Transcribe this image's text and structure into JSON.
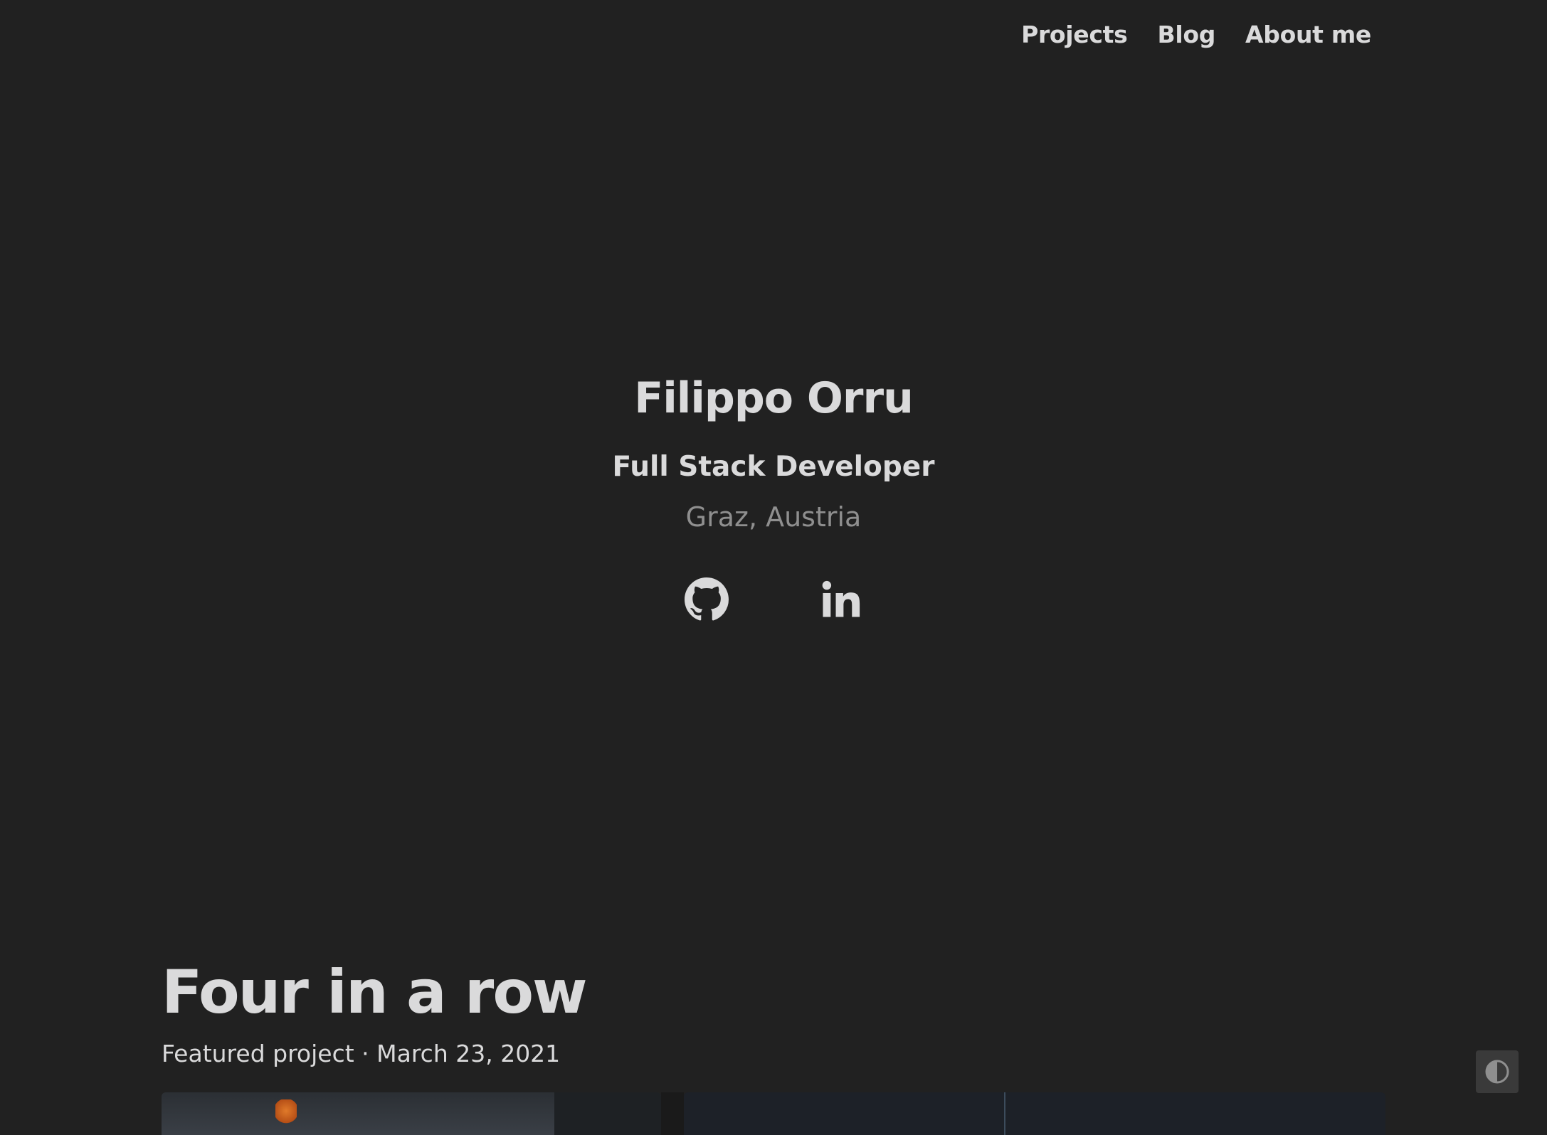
{
  "nav": {
    "items": [
      {
        "label": "Projects"
      },
      {
        "label": "Blog"
      },
      {
        "label": "About me"
      }
    ]
  },
  "hero": {
    "name": "Filippo Orru",
    "role": "Full Stack Developer",
    "location": "Graz, Austria",
    "social": [
      {
        "icon": "github-icon"
      },
      {
        "icon": "linkedin-icon"
      }
    ]
  },
  "featured_project": {
    "title": "Four in a row",
    "meta": "Featured project · March 23, 2021"
  },
  "theme_toggle": {
    "icon": "contrast-icon"
  },
  "colors": {
    "background": "#212121",
    "text": "#dadadb",
    "muted_text": "#8f8f8f",
    "toggle_bg": "#3a3a3a"
  }
}
